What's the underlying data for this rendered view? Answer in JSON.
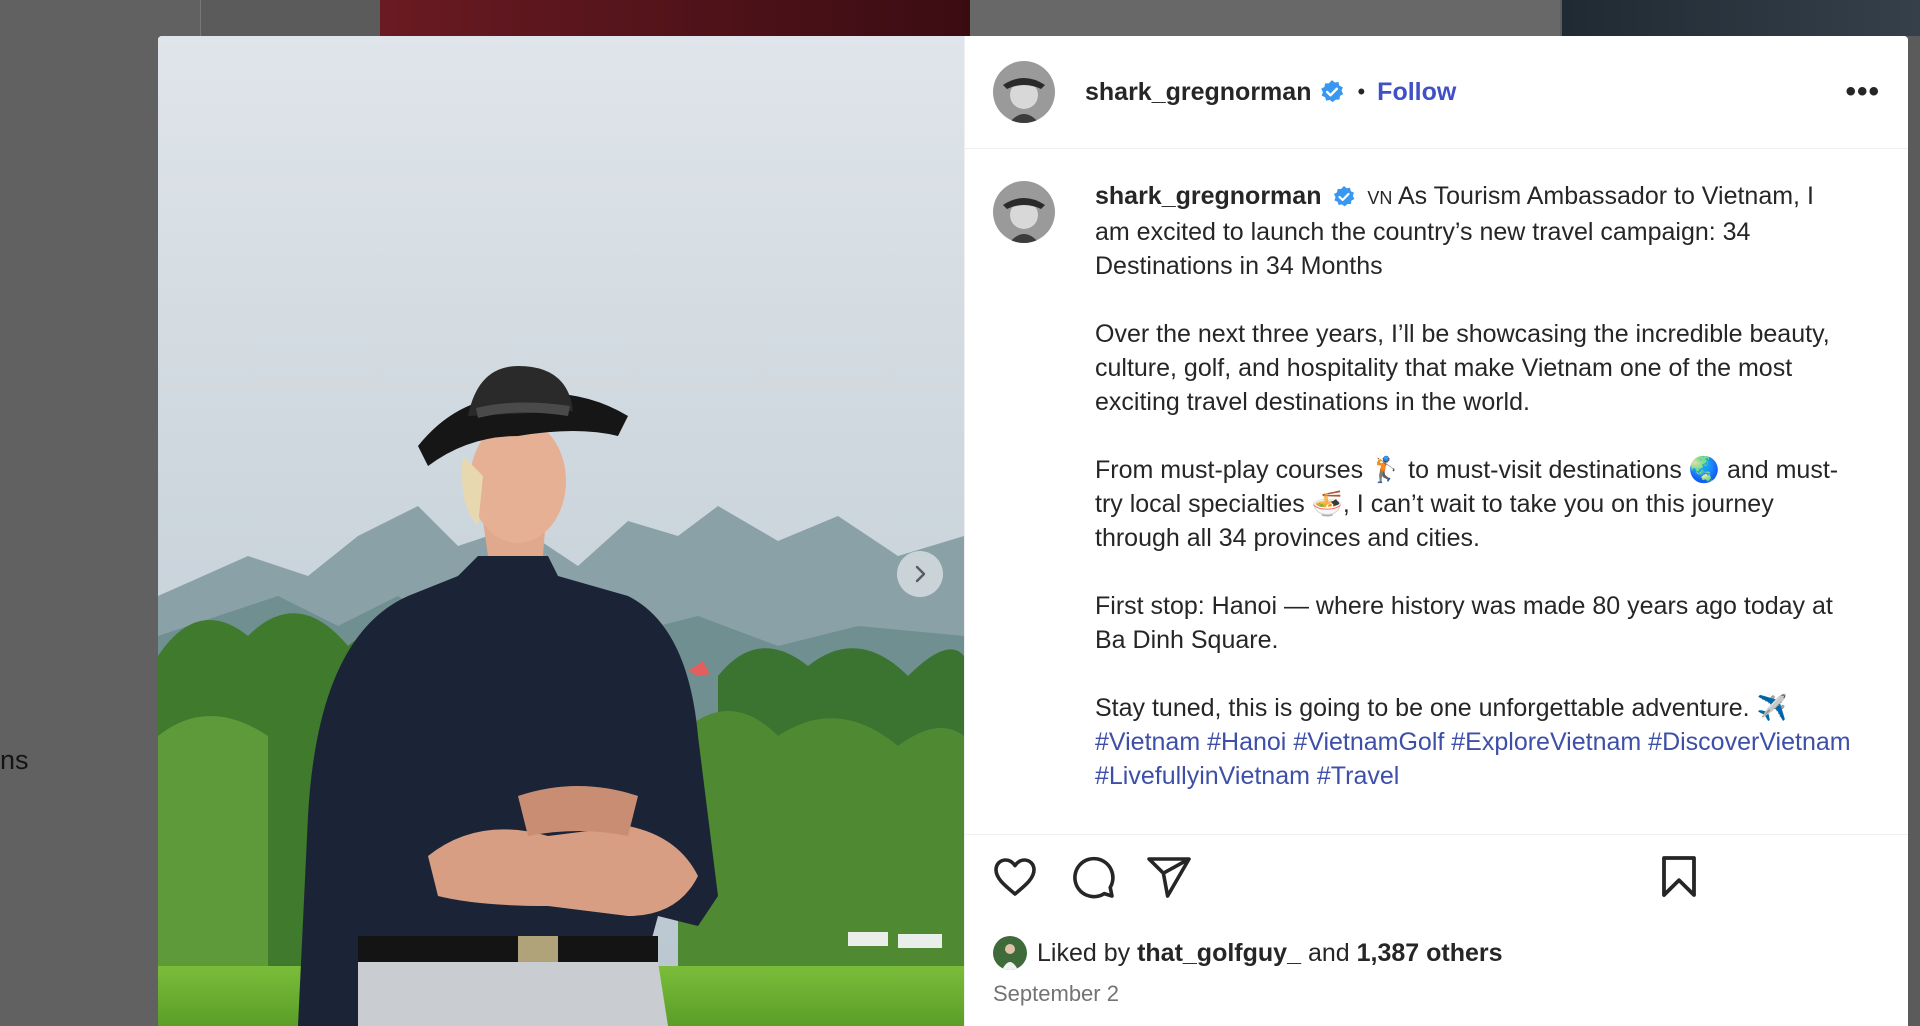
{
  "background": {
    "partial_text": "ns"
  },
  "post": {
    "author": "shark_gregnorman",
    "follow_label": "Follow",
    "separator": "•",
    "more_label": "•••",
    "caption": {
      "username": "shark_gregnorman",
      "flag_label": "VN",
      "para1": "As Tourism Ambassador to Vietnam, I am excited to launch the country’s new travel campaign: 34 Destinations in 34 Months",
      "para2": "Over the next three years, I’ll be showcasing the incredible beauty, culture, golf, and hospitality that make Vietnam one of the most exciting travel destinations in the world.",
      "para3_a": "From must-play courses",
      "para3_emoji1": "🏌️",
      "para3_b": "to must-visit destinations",
      "para3_emoji2": "🌏",
      "para3_c": "and must-try local specialties",
      "para3_emoji3": "🍜",
      "para3_d": ", I can’t wait to take you on this journey through all 34 provinces and cities.",
      "para4": "First stop: Hanoi — where history was made 80 years ago today at Ba Dinh Square.",
      "para5": "Stay tuned, this is going to be one unforgettable adventure.",
      "para5_emoji": "✈️",
      "hashtags": [
        "#Vietnam",
        "#Hanoi",
        "#VietnamGolf",
        "#ExploreVietnam",
        "#DiscoverVietnam",
        "#LivefullyinVietnam",
        "#Travel"
      ]
    },
    "likes": {
      "prefix": "Liked by",
      "user": "that_golfguy_",
      "middle": "and",
      "count": "1,387 others"
    },
    "date": "September 2"
  },
  "colors": {
    "link": "#4150c4",
    "hashtag": "#3d4fa8",
    "verified": "#3897f0",
    "text": "#262626",
    "muted": "#737373"
  },
  "icons": [
    "verified-badge-icon",
    "more-options-icon",
    "next-arrow-icon",
    "heart-icon",
    "comment-icon",
    "share-icon",
    "bookmark-icon"
  ]
}
